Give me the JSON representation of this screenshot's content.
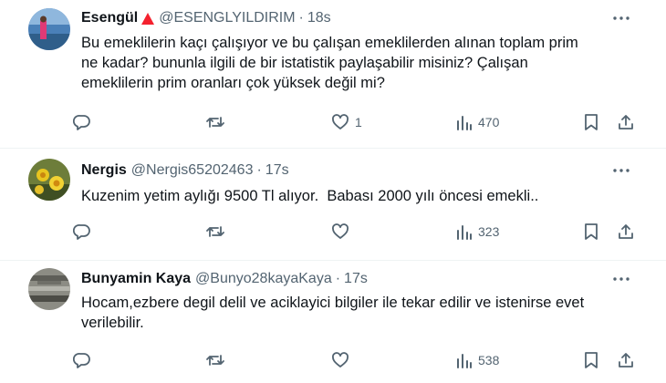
{
  "tweets": [
    {
      "name": "Esengül",
      "badge_icon": "warning-triangle-icon",
      "badge_color": "#f4212e",
      "handle": "@ESENGLYILDIRIM",
      "dot": "·",
      "time": "18s",
      "text": "Bu emeklilerin kaçı çalışıyor ve bu çalışan emeklilerden alınan toplam prim\nne kadar? bununla ilgili de bir istatistik paylaşabilir misiniz? Çalışan\nemeklilerin prim oranları çok yüksek değil mi?",
      "reply_count": "",
      "retweet_count": "",
      "like_count": "1",
      "views_count": "470"
    },
    {
      "name": "Nergis",
      "handle": "@Nergis65202463",
      "dot": "·",
      "time": "17s",
      "text": "Kuzenim yetim aylığı 9500 Tl alıyor.  Babası 2000 yılı öncesi emekli..",
      "reply_count": "",
      "retweet_count": "",
      "like_count": "",
      "views_count": "323"
    },
    {
      "name": "Bunyamin Kaya",
      "handle": "@Bunyo28kayaKaya",
      "dot": "·",
      "time": "17s",
      "text": "Hocam,ezbere degil delil ve aciklayici bilgiler ile tekar edilir ve istenirse evet\nverilebilir.",
      "reply_count": "",
      "retweet_count": "",
      "like_count": "",
      "views_count": "538"
    }
  ],
  "icons": {
    "more": "more-icon",
    "reply": "reply-icon",
    "retweet": "retweet-icon",
    "like": "like-icon",
    "views": "views-icon",
    "bookmark": "bookmark-icon",
    "share": "share-icon"
  },
  "colors": {
    "text": "#0f1419",
    "secondary": "#536471",
    "divider": "#eff3f4"
  }
}
